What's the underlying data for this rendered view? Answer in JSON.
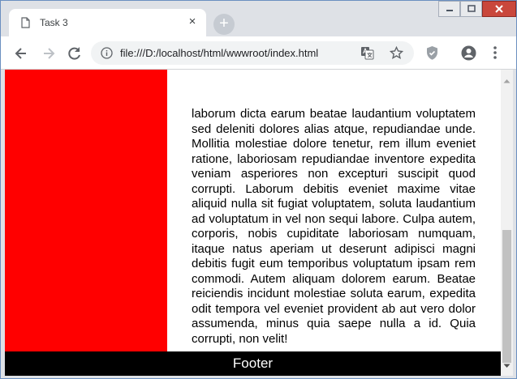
{
  "tab": {
    "title": "Task 3",
    "close_glyph": "×"
  },
  "new_tab_glyph": "+",
  "address_bar": {
    "url": "file:///D:/localhost/html/wwwroot/index.html"
  },
  "page": {
    "body_text": "laborum dicta earum beatae laudantium voluptatem sed deleniti dolores alias atque, repudiandae unde. Mollitia molestiae dolore tenetur, rem illum eveniet ratione, laboriosam repudiandae inventore expedita veniam asperiores non excepturi suscipit quod corrupti. Laborum debitis eveniet maxime vitae aliquid nulla sit fugiat voluptatem, soluta laudantium ad voluptatum in vel non sequi labore. Culpa autem, corporis, nobis cupiditate laboriosam numquam, itaque natus aperiam ut deserunt adipisci magni debitis fugit eum temporibus voluptatum ipsam rem commodi. Autem aliquam dolorem earum. Beatae reiciendis incidunt molestiae soluta earum, expedita odit tempora vel eveniet provident ab aut vero dolor assumenda, minus quia saepe nulla a id. Quia corrupti, non velit!",
    "footer_text": "Footer"
  },
  "colors": {
    "sidebar": "#ff0000",
    "footer_bg": "#000000",
    "footer_text": "#ffffff"
  }
}
